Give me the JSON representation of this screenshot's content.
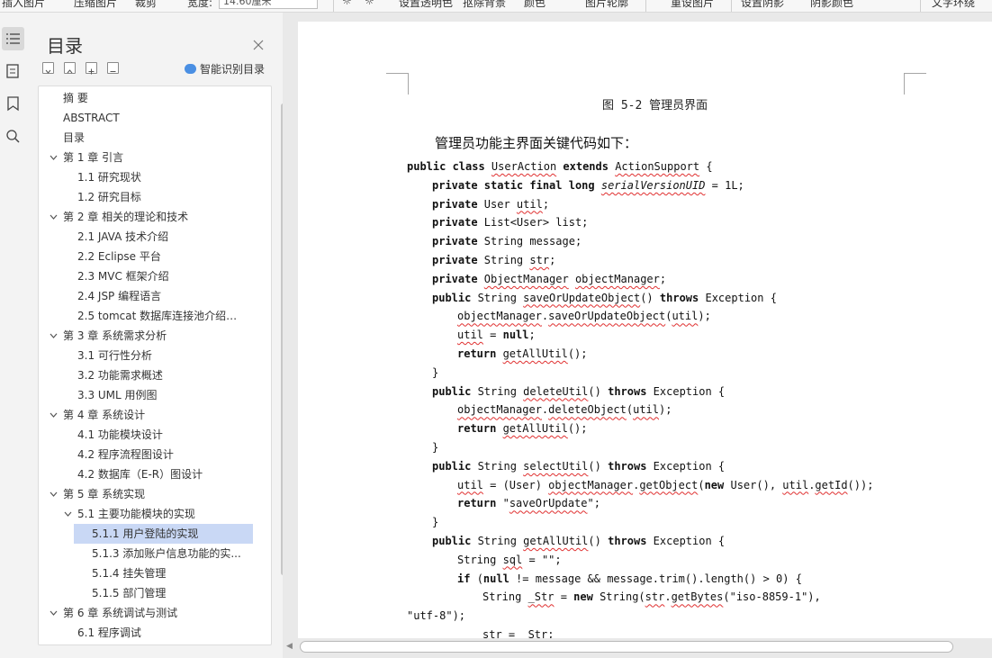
{
  "toolbar": {
    "items": [
      "插入图片",
      "压缩图片",
      "裁剪",
      "宽度:",
      "14.60厘米",
      "设置透明色",
      "抠除背景",
      "颜色",
      "图片轮廓",
      "重设图片",
      "设置阴影",
      "阴影颜色",
      "文字环绕"
    ]
  },
  "toc": {
    "title": "目录",
    "smart_label": "智能识别目录",
    "items": [
      {
        "label": "摘 要",
        "level": 0,
        "expand": "none"
      },
      {
        "label": "ABSTRACT",
        "level": 0,
        "expand": "none"
      },
      {
        "label": "目录",
        "level": 0,
        "expand": "none"
      },
      {
        "label": "第 1 章 引言",
        "level": 0,
        "expand": "open"
      },
      {
        "label": "1.1 研究现状",
        "level": 1,
        "expand": "none"
      },
      {
        "label": "1.2 研究目标",
        "level": 1,
        "expand": "none"
      },
      {
        "label": "第 2 章 相关的理论和技术",
        "level": 0,
        "expand": "open"
      },
      {
        "label": "2.1 JAVA 技术介绍",
        "level": 1,
        "expand": "none"
      },
      {
        "label": "2.2 Eclipse 平台",
        "level": 1,
        "expand": "none"
      },
      {
        "label": "2.3 MVC 框架介绍",
        "level": 1,
        "expand": "none"
      },
      {
        "label": "2.4 JSP 编程语言",
        "level": 1,
        "expand": "none"
      },
      {
        "label": "2.5 tomcat 数据库连接池介绍与 ...",
        "level": 1,
        "expand": "none"
      },
      {
        "label": "第 3 章 系统需求分析",
        "level": 0,
        "expand": "open"
      },
      {
        "label": "3.1 可行性分析",
        "level": 1,
        "expand": "none"
      },
      {
        "label": "3.2 功能需求概述",
        "level": 1,
        "expand": "none"
      },
      {
        "label": "3.3 UML 用例图",
        "level": 1,
        "expand": "none"
      },
      {
        "label": "第 4 章 系统设计",
        "level": 0,
        "expand": "open"
      },
      {
        "label": "4.1 功能模块设计",
        "level": 1,
        "expand": "none"
      },
      {
        "label": "4.2 程序流程图设计",
        "level": 1,
        "expand": "none"
      },
      {
        "label": "4.2 数据库（E-R）图设计",
        "level": 1,
        "expand": "none"
      },
      {
        "label": "第 5 章 系统实现",
        "level": 0,
        "expand": "open"
      },
      {
        "label": "5.1 主要功能模块的实现",
        "level": 1,
        "expand": "open"
      },
      {
        "label": "5.1.1 用户登陆的实现",
        "level": 2,
        "expand": "none",
        "selected": true
      },
      {
        "label": "5.1.3 添加账户信息功能的实...",
        "level": 2,
        "expand": "none"
      },
      {
        "label": "5.1.4 挂失管理",
        "level": 2,
        "expand": "none"
      },
      {
        "label": "5.1.5 部门管理",
        "level": 2,
        "expand": "none"
      },
      {
        "label": "第 6 章 系统调试与测试",
        "level": 0,
        "expand": "open"
      },
      {
        "label": "6.1 程序调试",
        "level": 1,
        "expand": "none"
      }
    ]
  },
  "document": {
    "figure_caption": "图 5-2 管理员界面",
    "intro": "管理员功能主界面关键代码如下：",
    "code_lines": [
      {
        "indent": 0,
        "segs": [
          [
            "public class ",
            "kw"
          ],
          [
            "UserAction",
            "sq"
          ],
          [
            " extends ",
            "kw"
          ],
          [
            "ActionSupport",
            "sq"
          ],
          [
            " {",
            ""
          ]
        ]
      },
      {
        "indent": 1,
        "segs": [
          [
            "private static final long ",
            "kw"
          ],
          [
            "serialVersionUID",
            "sq it"
          ],
          [
            " = 1L;",
            ""
          ]
        ]
      },
      {
        "indent": 1,
        "segs": [
          [
            "private ",
            "kw"
          ],
          [
            "User ",
            ""
          ],
          [
            "util",
            "sq"
          ],
          [
            ";",
            ""
          ]
        ]
      },
      {
        "indent": 1,
        "segs": [
          [
            "private ",
            "kw"
          ],
          [
            "List<User> list;",
            ""
          ]
        ]
      },
      {
        "indent": 1,
        "segs": [
          [
            "private ",
            "kw"
          ],
          [
            "String message;",
            ""
          ]
        ]
      },
      {
        "indent": 1,
        "segs": [
          [
            "private ",
            "kw"
          ],
          [
            "String ",
            ""
          ],
          [
            "str",
            "sq"
          ],
          [
            ";",
            ""
          ]
        ]
      },
      {
        "indent": 1,
        "segs": [
          [
            "private ",
            "kw"
          ],
          [
            "ObjectManager",
            "sq"
          ],
          [
            " ",
            ""
          ],
          [
            "objectManager",
            "sq"
          ],
          [
            ";",
            ""
          ]
        ]
      },
      {
        "indent": 1,
        "segs": [
          [
            "public ",
            "kw"
          ],
          [
            "String ",
            ""
          ],
          [
            "saveOrUpdateObject",
            "sq"
          ],
          [
            "() ",
            ""
          ],
          [
            "throws ",
            "kw"
          ],
          [
            "Exception {",
            ""
          ]
        ]
      },
      {
        "indent": 2,
        "segs": [
          [
            "objectManager",
            "sq"
          ],
          [
            ".",
            ""
          ],
          [
            "saveOrUpdateObject",
            "sq"
          ],
          [
            "(",
            ""
          ],
          [
            "util",
            "sq"
          ],
          [
            ");",
            ""
          ]
        ]
      },
      {
        "indent": 2,
        "segs": [
          [
            "util",
            "sq"
          ],
          [
            " = ",
            ""
          ],
          [
            "null",
            "kw"
          ],
          [
            ";",
            ""
          ]
        ]
      },
      {
        "indent": 2,
        "segs": [
          [
            "return ",
            "kw"
          ],
          [
            "getAllUtil",
            "sq"
          ],
          [
            "();",
            ""
          ]
        ]
      },
      {
        "indent": 1,
        "segs": [
          [
            "}",
            ""
          ]
        ]
      },
      {
        "indent": 1,
        "segs": [
          [
            "public ",
            "kw"
          ],
          [
            "String ",
            ""
          ],
          [
            "deleteUtil",
            "sq"
          ],
          [
            "() ",
            ""
          ],
          [
            "throws ",
            "kw"
          ],
          [
            "Exception {",
            ""
          ]
        ]
      },
      {
        "indent": 2,
        "segs": [
          [
            "objectManager",
            "sq"
          ],
          [
            ".",
            ""
          ],
          [
            "deleteObject",
            "sq"
          ],
          [
            "(",
            ""
          ],
          [
            "util",
            "sq"
          ],
          [
            ");",
            ""
          ]
        ]
      },
      {
        "indent": 2,
        "segs": [
          [
            "return ",
            "kw"
          ],
          [
            "getAllUtil",
            "sq"
          ],
          [
            "();",
            ""
          ]
        ]
      },
      {
        "indent": 1,
        "segs": [
          [
            "}",
            ""
          ]
        ]
      },
      {
        "indent": 1,
        "segs": [
          [
            "public ",
            "kw"
          ],
          [
            "String ",
            ""
          ],
          [
            "selectUtil",
            "sq"
          ],
          [
            "() ",
            ""
          ],
          [
            "throws ",
            "kw"
          ],
          [
            "Exception {",
            ""
          ]
        ]
      },
      {
        "indent": 2,
        "segs": [
          [
            "util",
            "sq"
          ],
          [
            " = (User) ",
            ""
          ],
          [
            "objectManager",
            "sq"
          ],
          [
            ".",
            ""
          ],
          [
            "getObject",
            "sq"
          ],
          [
            "(",
            ""
          ],
          [
            "new ",
            "kw"
          ],
          [
            "User(), ",
            ""
          ],
          [
            "util",
            "sq"
          ],
          [
            ".",
            ""
          ],
          [
            "getId",
            "sq"
          ],
          [
            "());",
            ""
          ]
        ]
      },
      {
        "indent": 2,
        "segs": [
          [
            "return ",
            "kw"
          ],
          [
            "\"",
            ""
          ],
          [
            "saveOrUpdate",
            "sq"
          ],
          [
            "\";",
            ""
          ]
        ]
      },
      {
        "indent": 1,
        "segs": [
          [
            "}",
            ""
          ]
        ]
      },
      {
        "indent": 1,
        "segs": [
          [
            "public ",
            "kw"
          ],
          [
            "String ",
            ""
          ],
          [
            "getAllUtil",
            "sq"
          ],
          [
            "() ",
            ""
          ],
          [
            "throws ",
            "kw"
          ],
          [
            "Exception {",
            ""
          ]
        ]
      },
      {
        "indent": 2,
        "segs": [
          [
            "String ",
            ""
          ],
          [
            "sql",
            "sq"
          ],
          [
            " = \"\";",
            ""
          ]
        ]
      },
      {
        "indent": 2,
        "segs": [
          [
            "if ",
            "kw"
          ],
          [
            "(",
            ""
          ],
          [
            "null ",
            "kw"
          ],
          [
            "!= message && message.trim().length() > 0) {",
            ""
          ]
        ]
      },
      {
        "indent": 3,
        "segs": [
          [
            "String ",
            ""
          ],
          [
            "_Str",
            "sq"
          ],
          [
            " = ",
            ""
          ],
          [
            "new ",
            "kw"
          ],
          [
            "String(",
            ""
          ],
          [
            "str",
            "sq"
          ],
          [
            ".",
            ""
          ],
          [
            "getBytes",
            "sq"
          ],
          [
            "(\"iso-8859-1\"),",
            ""
          ]
        ]
      },
      {
        "indent": 0,
        "segs": [
          [
            "\"utf-8\");",
            ""
          ]
        ]
      },
      {
        "indent": 3,
        "segs": [
          [
            "str = ",
            ""
          ],
          [
            "_Str",
            "sq"
          ],
          [
            ";",
            ""
          ]
        ]
      }
    ]
  }
}
